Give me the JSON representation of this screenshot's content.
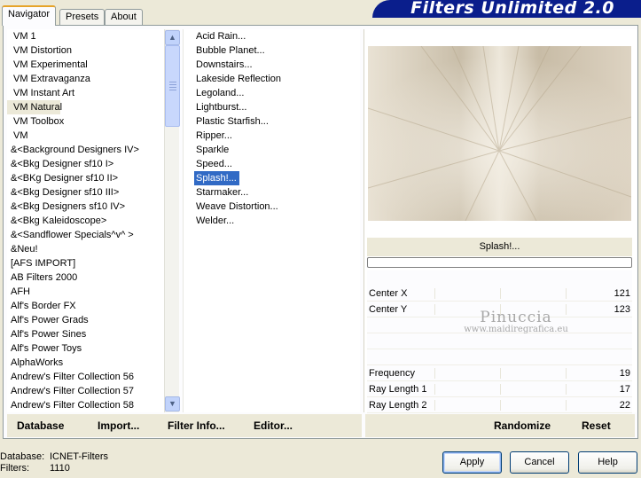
{
  "tabs": [
    {
      "label": "Navigator",
      "active": true
    },
    {
      "label": "Presets",
      "active": false
    },
    {
      "label": "About",
      "active": false
    }
  ],
  "app_title": "Filters Unlimited 2.0",
  "categories": [
    "VM 1",
    "VM Distortion",
    "VM Experimental",
    "VM Extravaganza",
    "VM Instant Art",
    "VM Natural",
    "VM Toolbox",
    "VM",
    "&<Background Designers IV>",
    "&<Bkg Designer sf10 I>",
    "&<BKg Designer sf10 II>",
    "&<Bkg Designer sf10 III>",
    "&<Bkg Designers sf10 IV>",
    "&<Bkg Kaleidoscope>",
    "&<Sandflower Specials^v^ >",
    "&Neu!",
    "[AFS IMPORT]",
    "AB Filters 2000",
    "AFH",
    "Alf's Border FX",
    "Alf's Power Grads",
    "Alf's Power Sines",
    "Alf's Power Toys",
    "AlphaWorks",
    "Andrew's Filter Collection 56",
    "Andrew's Filter Collection 57",
    "Andrew's Filter Collection 58"
  ],
  "selected_category": "VM Natural",
  "filters": [
    "Acid Rain...",
    "Bubble Planet...",
    "Downstairs...",
    "Lakeside Reflection",
    "Legoland...",
    "Lightburst...",
    "Plastic Starfish...",
    "Ripper...",
    "Sparkle",
    "Speed...",
    "Splash!...",
    "Starmaker...",
    "Weave Distortion...",
    "Welder..."
  ],
  "selected_filter": "Splash!...",
  "filter_name_bar": "Splash!...",
  "params_top": [
    {
      "label": "Center X",
      "value": "121"
    },
    {
      "label": "Center Y",
      "value": "123"
    }
  ],
  "params_bottom": [
    {
      "label": "Frequency",
      "value": "19"
    },
    {
      "label": "Ray Length 1",
      "value": "17"
    },
    {
      "label": "Ray Length 2",
      "value": "22"
    }
  ],
  "watermark": {
    "line1": "Pinuccia",
    "line2": "www.maidiregrafica.eu"
  },
  "left_toolbar": {
    "database": "Database",
    "import": "Import...",
    "filter_info": "Filter Info...",
    "editor": "Editor..."
  },
  "right_toolbar": {
    "randomize": "Randomize",
    "reset": "Reset"
  },
  "status": {
    "database_label": "Database:",
    "database_value": "ICNET-Filters",
    "filters_label": "Filters:",
    "filters_value": "1110"
  },
  "buttons": {
    "apply": "Apply",
    "cancel": "Cancel",
    "help": "Help"
  },
  "colors": {
    "banner": "#0a1e8c",
    "selection": "#316ac5",
    "preview_tone": "#d8cebc"
  }
}
